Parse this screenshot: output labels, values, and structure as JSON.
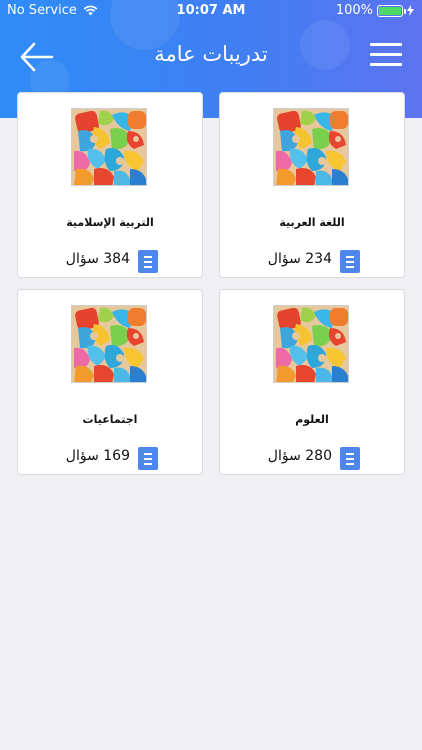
{
  "status_bar": {
    "carrier": "No Service",
    "time": "10:07 AM",
    "battery_percent": "100%",
    "battery_level": 1.0
  },
  "header": {
    "title": "تدريبات عامة",
    "back_icon": "arrow-left-icon",
    "menu_icon": "hamburger-menu-icon",
    "gradient": [
      "#2f8cf6",
      "#5d73f0"
    ]
  },
  "cards": [
    {
      "title": "اللغة العربية",
      "count": "234 سؤال",
      "icon": "document-icon"
    },
    {
      "title": "التربية الإسلامية",
      "count": "384 سؤال",
      "icon": "document-icon"
    },
    {
      "title": "العلوم",
      "count": "280 سؤال",
      "icon": "document-icon"
    },
    {
      "title": "اجتماعيات",
      "count": "169 سؤال",
      "icon": "document-icon"
    }
  ],
  "colors": {
    "accent": "#4d87ee",
    "background": "#efeff4",
    "battery": "#4cd964"
  }
}
